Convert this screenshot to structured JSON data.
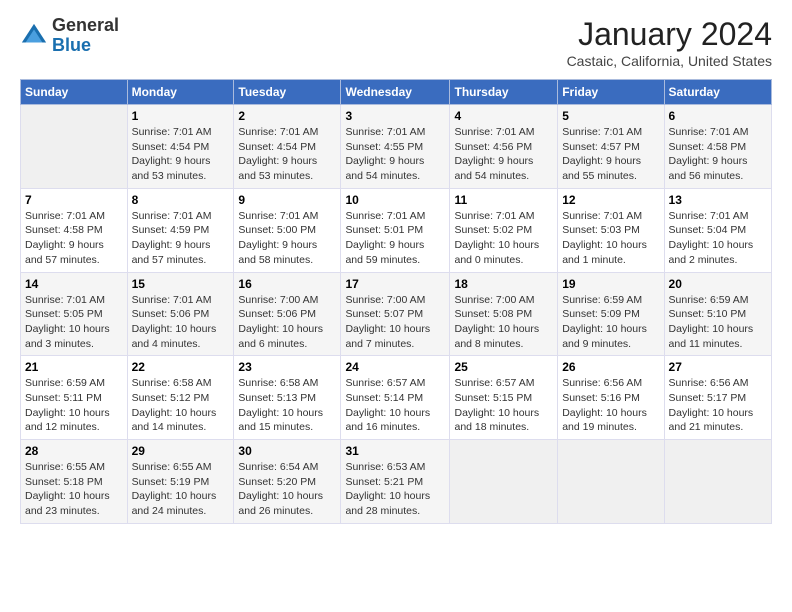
{
  "header": {
    "logo_general": "General",
    "logo_blue": "Blue",
    "month_title": "January 2024",
    "location": "Castaic, California, United States"
  },
  "calendar": {
    "days_of_week": [
      "Sunday",
      "Monday",
      "Tuesday",
      "Wednesday",
      "Thursday",
      "Friday",
      "Saturday"
    ],
    "weeks": [
      [
        {
          "day": "",
          "info": ""
        },
        {
          "day": "1",
          "info": "Sunrise: 7:01 AM\nSunset: 4:54 PM\nDaylight: 9 hours\nand 53 minutes."
        },
        {
          "day": "2",
          "info": "Sunrise: 7:01 AM\nSunset: 4:54 PM\nDaylight: 9 hours\nand 53 minutes."
        },
        {
          "day": "3",
          "info": "Sunrise: 7:01 AM\nSunset: 4:55 PM\nDaylight: 9 hours\nand 54 minutes."
        },
        {
          "day": "4",
          "info": "Sunrise: 7:01 AM\nSunset: 4:56 PM\nDaylight: 9 hours\nand 54 minutes."
        },
        {
          "day": "5",
          "info": "Sunrise: 7:01 AM\nSunset: 4:57 PM\nDaylight: 9 hours\nand 55 minutes."
        },
        {
          "day": "6",
          "info": "Sunrise: 7:01 AM\nSunset: 4:58 PM\nDaylight: 9 hours\nand 56 minutes."
        }
      ],
      [
        {
          "day": "7",
          "info": "Sunrise: 7:01 AM\nSunset: 4:58 PM\nDaylight: 9 hours\nand 57 minutes."
        },
        {
          "day": "8",
          "info": "Sunrise: 7:01 AM\nSunset: 4:59 PM\nDaylight: 9 hours\nand 57 minutes."
        },
        {
          "day": "9",
          "info": "Sunrise: 7:01 AM\nSunset: 5:00 PM\nDaylight: 9 hours\nand 58 minutes."
        },
        {
          "day": "10",
          "info": "Sunrise: 7:01 AM\nSunset: 5:01 PM\nDaylight: 9 hours\nand 59 minutes."
        },
        {
          "day": "11",
          "info": "Sunrise: 7:01 AM\nSunset: 5:02 PM\nDaylight: 10 hours\nand 0 minutes."
        },
        {
          "day": "12",
          "info": "Sunrise: 7:01 AM\nSunset: 5:03 PM\nDaylight: 10 hours\nand 1 minute."
        },
        {
          "day": "13",
          "info": "Sunrise: 7:01 AM\nSunset: 5:04 PM\nDaylight: 10 hours\nand 2 minutes."
        }
      ],
      [
        {
          "day": "14",
          "info": "Sunrise: 7:01 AM\nSunset: 5:05 PM\nDaylight: 10 hours\nand 3 minutes."
        },
        {
          "day": "15",
          "info": "Sunrise: 7:01 AM\nSunset: 5:06 PM\nDaylight: 10 hours\nand 4 minutes."
        },
        {
          "day": "16",
          "info": "Sunrise: 7:00 AM\nSunset: 5:06 PM\nDaylight: 10 hours\nand 6 minutes."
        },
        {
          "day": "17",
          "info": "Sunrise: 7:00 AM\nSunset: 5:07 PM\nDaylight: 10 hours\nand 7 minutes."
        },
        {
          "day": "18",
          "info": "Sunrise: 7:00 AM\nSunset: 5:08 PM\nDaylight: 10 hours\nand 8 minutes."
        },
        {
          "day": "19",
          "info": "Sunrise: 6:59 AM\nSunset: 5:09 PM\nDaylight: 10 hours\nand 9 minutes."
        },
        {
          "day": "20",
          "info": "Sunrise: 6:59 AM\nSunset: 5:10 PM\nDaylight: 10 hours\nand 11 minutes."
        }
      ],
      [
        {
          "day": "21",
          "info": "Sunrise: 6:59 AM\nSunset: 5:11 PM\nDaylight: 10 hours\nand 12 minutes."
        },
        {
          "day": "22",
          "info": "Sunrise: 6:58 AM\nSunset: 5:12 PM\nDaylight: 10 hours\nand 14 minutes."
        },
        {
          "day": "23",
          "info": "Sunrise: 6:58 AM\nSunset: 5:13 PM\nDaylight: 10 hours\nand 15 minutes."
        },
        {
          "day": "24",
          "info": "Sunrise: 6:57 AM\nSunset: 5:14 PM\nDaylight: 10 hours\nand 16 minutes."
        },
        {
          "day": "25",
          "info": "Sunrise: 6:57 AM\nSunset: 5:15 PM\nDaylight: 10 hours\nand 18 minutes."
        },
        {
          "day": "26",
          "info": "Sunrise: 6:56 AM\nSunset: 5:16 PM\nDaylight: 10 hours\nand 19 minutes."
        },
        {
          "day": "27",
          "info": "Sunrise: 6:56 AM\nSunset: 5:17 PM\nDaylight: 10 hours\nand 21 minutes."
        }
      ],
      [
        {
          "day": "28",
          "info": "Sunrise: 6:55 AM\nSunset: 5:18 PM\nDaylight: 10 hours\nand 23 minutes."
        },
        {
          "day": "29",
          "info": "Sunrise: 6:55 AM\nSunset: 5:19 PM\nDaylight: 10 hours\nand 24 minutes."
        },
        {
          "day": "30",
          "info": "Sunrise: 6:54 AM\nSunset: 5:20 PM\nDaylight: 10 hours\nand 26 minutes."
        },
        {
          "day": "31",
          "info": "Sunrise: 6:53 AM\nSunset: 5:21 PM\nDaylight: 10 hours\nand 28 minutes."
        },
        {
          "day": "",
          "info": ""
        },
        {
          "day": "",
          "info": ""
        },
        {
          "day": "",
          "info": ""
        }
      ]
    ]
  }
}
